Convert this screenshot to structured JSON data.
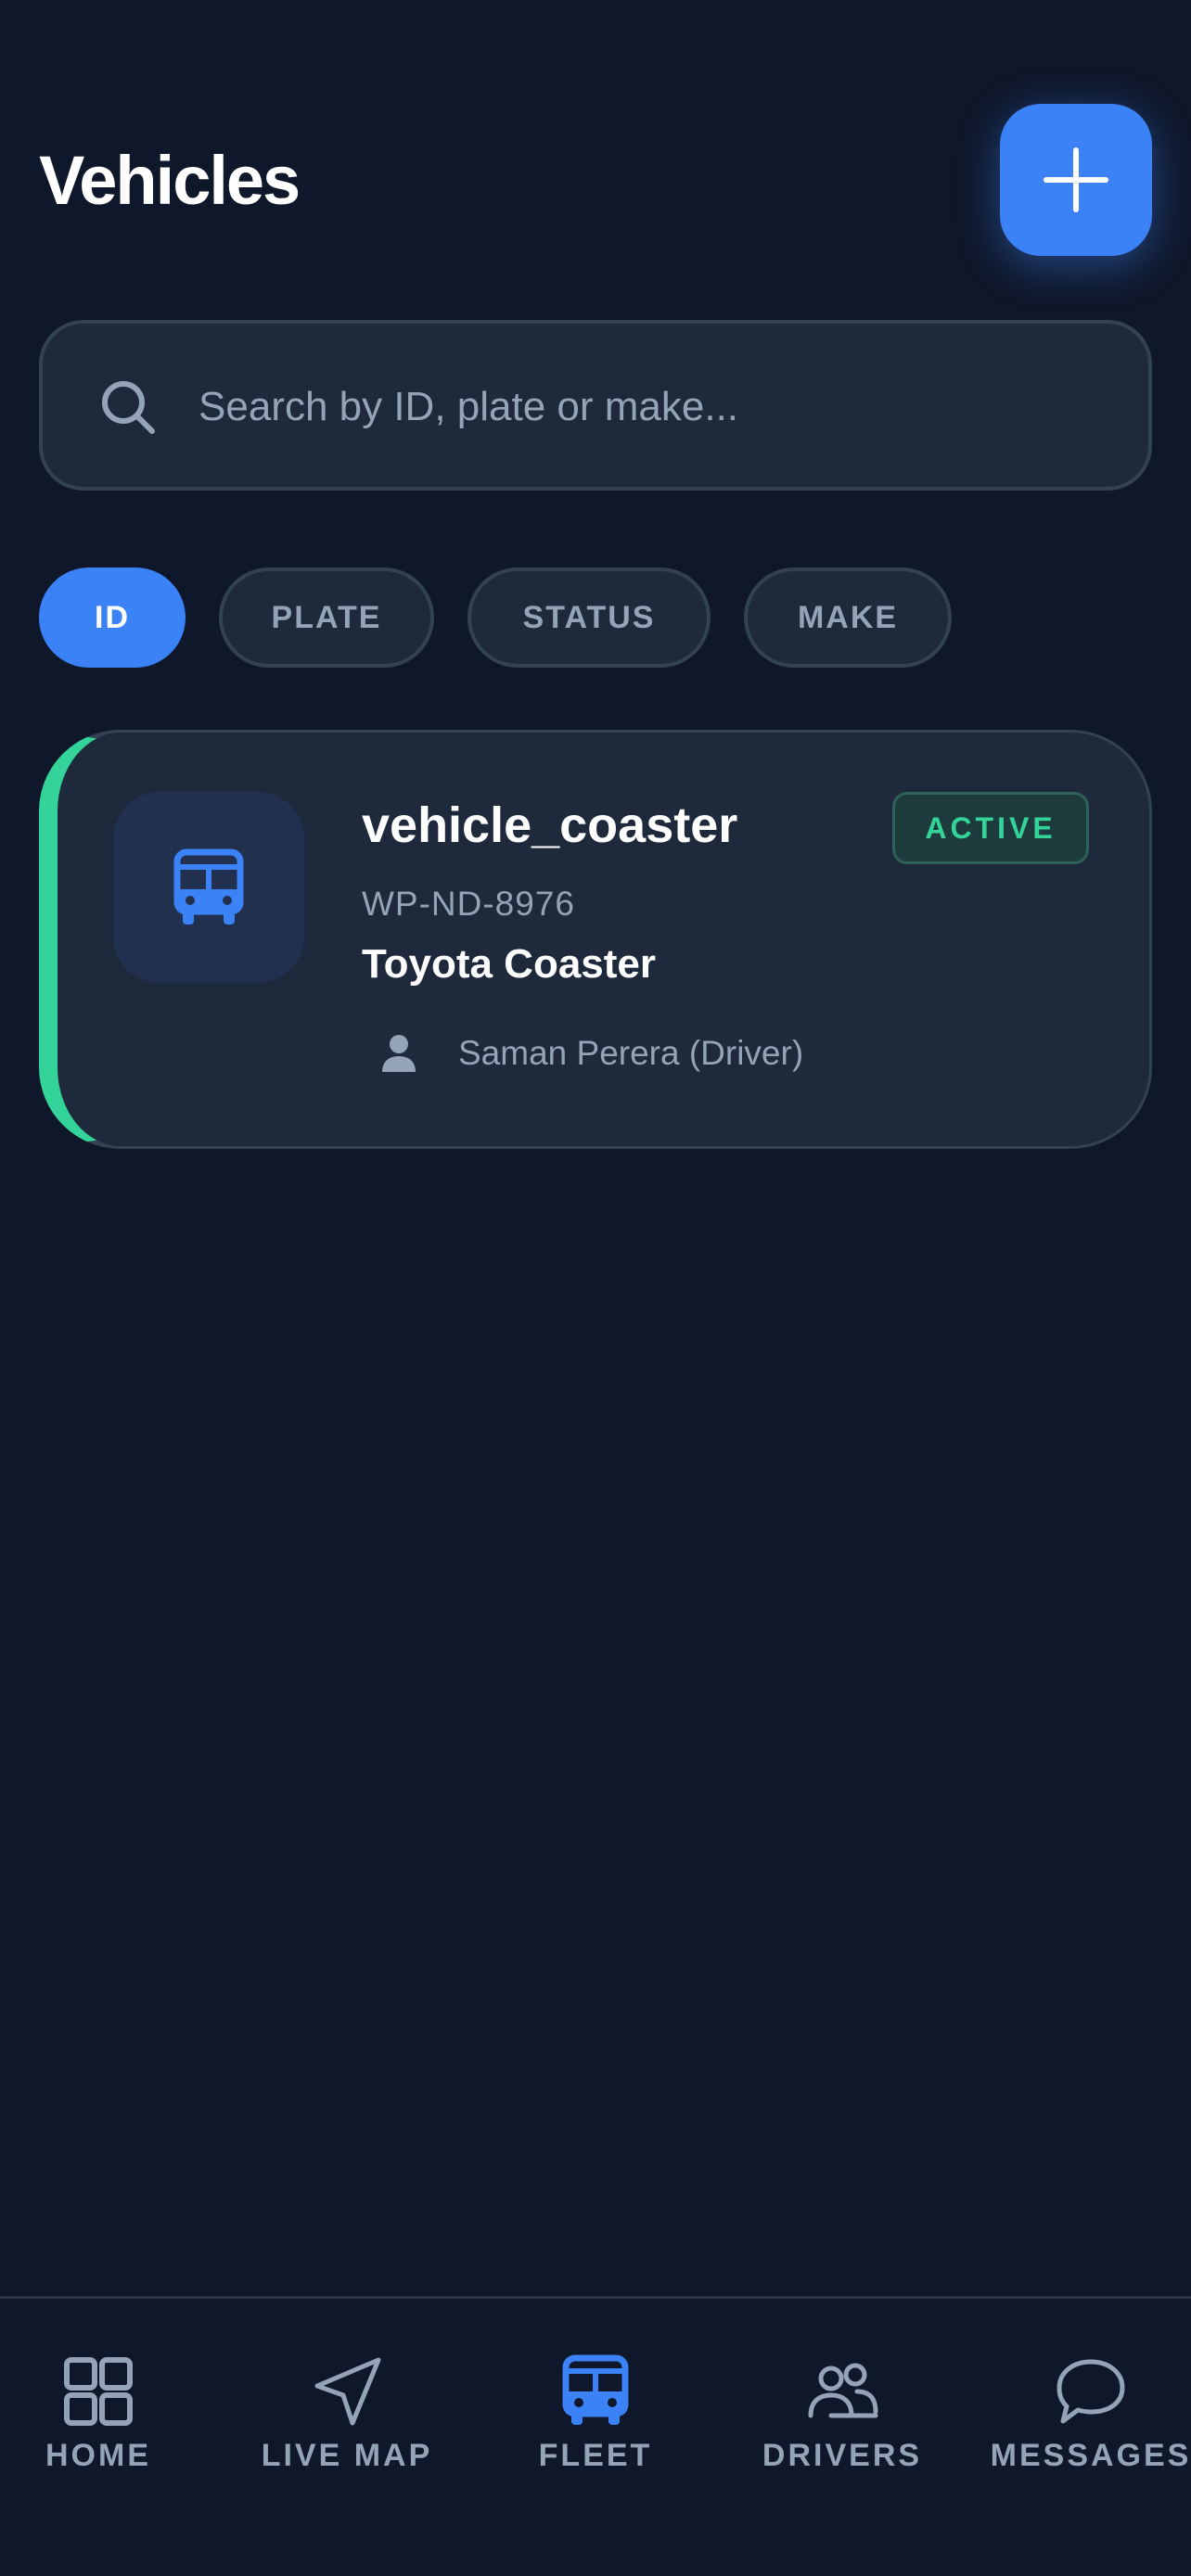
{
  "header": {
    "title": "Vehicles",
    "add_icon": "plus-icon"
  },
  "search": {
    "placeholder": "Search by ID, plate or make...",
    "value": "",
    "icon": "search-icon"
  },
  "filters": [
    {
      "label": "ID",
      "active": true
    },
    {
      "label": "PLATE",
      "active": false
    },
    {
      "label": "STATUS",
      "active": false
    },
    {
      "label": "MAKE",
      "active": false
    }
  ],
  "vehicles": [
    {
      "id": "vehicle_coaster",
      "plate": "WP-ND-8976",
      "model": "Toyota Coaster",
      "status": "ACTIVE",
      "driver": "Saman Perera (Driver)",
      "icon": "bus-icon",
      "status_color": "#34d399"
    }
  ],
  "nav": [
    {
      "label": "HOME",
      "icon": "grid-icon",
      "active": false
    },
    {
      "label": "LIVE MAP",
      "icon": "navigation-icon",
      "active": false
    },
    {
      "label": "FLEET",
      "icon": "bus-icon",
      "active": true
    },
    {
      "label": "DRIVERS",
      "icon": "users-icon",
      "active": false
    },
    {
      "label": "MESSAGES",
      "icon": "chat-icon",
      "active": false
    }
  ],
  "colors": {
    "background": "#0f172a",
    "surface": "#1e293b",
    "accent": "#3b82f6",
    "active_status": "#34d399",
    "muted": "#94a3b8"
  }
}
